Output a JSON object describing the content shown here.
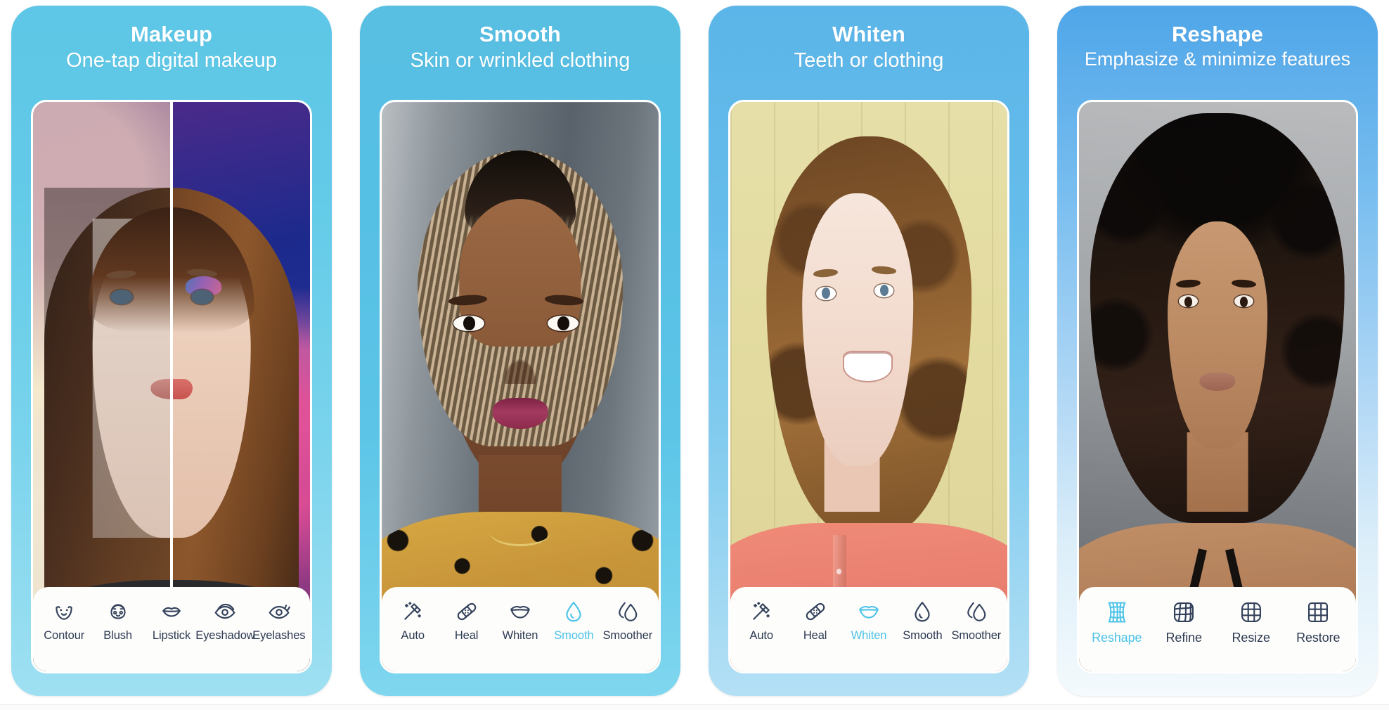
{
  "theme": {
    "accent": "#4cc3e8",
    "icon_color": "#33415c",
    "label_color": "#2d3a52",
    "toolbar_bg": "#fdfdfb",
    "page_bg": "#ffffff"
  },
  "cards": [
    {
      "id": "makeup",
      "title": "Makeup",
      "subtitle": "One-tap digital makeup",
      "photo_alt": "Before and after split portrait of a woman with digital makeup applied on the right half",
      "tools": [
        {
          "label": "Contour",
          "icon": "contour-icon",
          "active": false
        },
        {
          "label": "Blush",
          "icon": "blush-icon",
          "active": false
        },
        {
          "label": "Lipstick",
          "icon": "lipstick-icon",
          "active": false
        },
        {
          "label": "Eyeshadow",
          "icon": "eyeshadow-icon",
          "active": false
        },
        {
          "label": "Eyelashes",
          "icon": "eyelashes-icon",
          "active": false
        }
      ]
    },
    {
      "id": "smooth",
      "title": "Smooth",
      "subtitle": "Skin or wrinkled clothing",
      "photo_alt": "Portrait of a woman with braided hair wearing a leopard print shirt",
      "tools": [
        {
          "label": "Auto",
          "icon": "magic-wand-icon",
          "active": false
        },
        {
          "label": "Heal",
          "icon": "bandage-icon",
          "active": false
        },
        {
          "label": "Whiten",
          "icon": "teeth-icon",
          "active": false
        },
        {
          "label": "Smooth",
          "icon": "droplet-icon",
          "active": true
        },
        {
          "label": "Smoother",
          "icon": "droplets-icon",
          "active": false
        }
      ]
    },
    {
      "id": "whiten",
      "title": "Whiten",
      "subtitle": "Teeth or clothing",
      "photo_alt": "Smiling woman with curly hair in a coral shirt against a pale yellow wall",
      "tools": [
        {
          "label": "Auto",
          "icon": "magic-wand-icon",
          "active": false
        },
        {
          "label": "Heal",
          "icon": "bandage-icon",
          "active": false
        },
        {
          "label": "Whiten",
          "icon": "teeth-icon",
          "active": true
        },
        {
          "label": "Smooth",
          "icon": "droplet-icon",
          "active": false
        },
        {
          "label": "Smoother",
          "icon": "droplets-icon",
          "active": false
        }
      ]
    },
    {
      "id": "reshape",
      "title": "Reshape",
      "subtitle": "Emphasize & minimize features",
      "photo_alt": "Portrait of a woman with voluminous curly dark hair on a grey background",
      "tools": [
        {
          "label": "Reshape",
          "icon": "warp-grid-icon",
          "active": true
        },
        {
          "label": "Refine",
          "icon": "mesh-grid-icon",
          "active": false
        },
        {
          "label": "Resize",
          "icon": "rounded-grid-icon",
          "active": false
        },
        {
          "label": "Restore",
          "icon": "square-grid-icon",
          "active": false
        }
      ]
    }
  ]
}
